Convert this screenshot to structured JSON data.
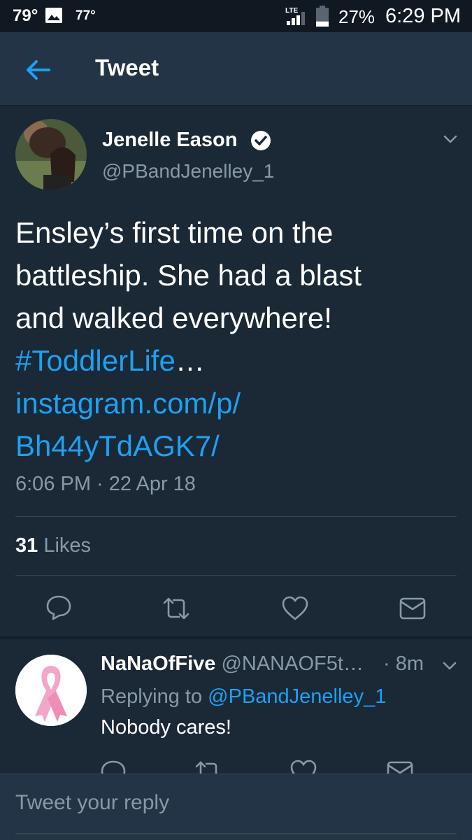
{
  "status_bar": {
    "temp_current": "79°",
    "temp_low": "77°",
    "network": "LTE",
    "battery_pct": "27%",
    "battery_level": 0.27,
    "time": "6:29 PM"
  },
  "header": {
    "title": "Tweet",
    "back_icon": "back-arrow-icon"
  },
  "tweet": {
    "author_name": "Jenelle Eason",
    "author_handle": "@PBandJenelley_1",
    "verified": true,
    "text_lines": [
      "Ensley’s first time on the",
      "battleship. She had a blast",
      "and walked everywhere!"
    ],
    "hashtag": "#ToddlerLife",
    "hashtag_suffix": "…",
    "link_line1": "instagram.com/p/",
    "link_line2": "Bh44yTdAGK7/",
    "timestamp": "6:06 PM · 22 Apr 18",
    "likes_count": "31",
    "likes_label": "Likes"
  },
  "actions": [
    "reply-icon",
    "retweet-icon",
    "like-icon",
    "dm-icon"
  ],
  "reply": {
    "name": "NaNaOfFive",
    "handle": "@NANAOF5t…",
    "time": "· 8m",
    "replying_prefix": "Replying to",
    "replying_to": "@PBandJenelley_1",
    "text": "Nobody cares!"
  },
  "composer": {
    "placeholder": "Tweet your reply"
  },
  "colors": {
    "background": "#1b2836",
    "header": "#243447",
    "accent": "#1da1f2",
    "muted": "#8899a6"
  }
}
